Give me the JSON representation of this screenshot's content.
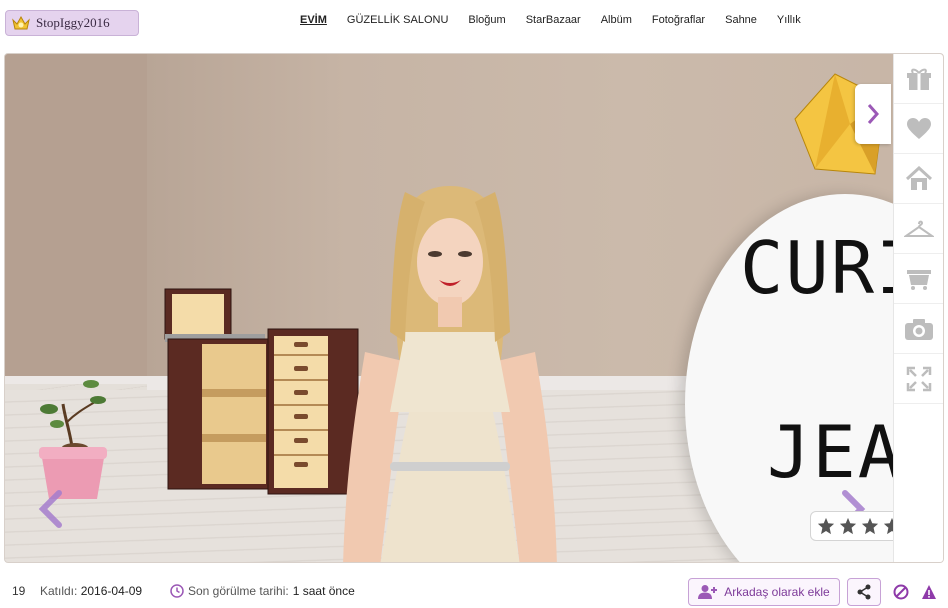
{
  "user": {
    "name": "StopIggy2016",
    "level": "19",
    "joined_label": "Katıldı:",
    "joined_date": "2016-04-09",
    "last_seen_label": "Son görülme tarihi:",
    "last_seen_value": "1 saat önce"
  },
  "nav": {
    "items": [
      "EVİM",
      "GÜZELLİK SALONU",
      "Bloğum",
      "StarBazaar",
      "Albüm",
      "Fotoğraflar",
      "Sahne",
      "Yıllık"
    ],
    "active": "EVİM"
  },
  "scene": {
    "poster_text_1": "CURI",
    "poster_text_2": "JEA"
  },
  "sidebar": {
    "icons": [
      "gift-icon",
      "heart-icon",
      "home-icon",
      "hanger-icon",
      "cart-icon",
      "camera-icon",
      "expand-icon"
    ]
  },
  "rating": {
    "stars_filled": 0,
    "stars_total": 5
  },
  "actions": {
    "add_friend": "Arkadaş olarak ekle"
  },
  "colors": {
    "accent": "#9b59b6",
    "accent_text": "#7d3a99",
    "pill_bg": "#e5d3ee",
    "icon_grey": "#bdbdbd"
  }
}
